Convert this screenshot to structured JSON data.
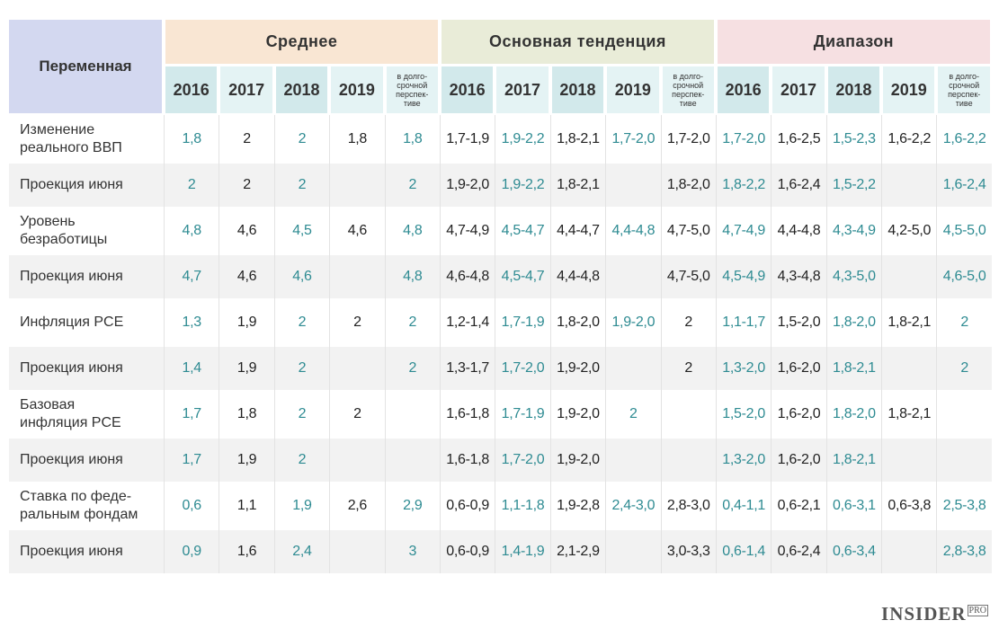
{
  "header": {
    "variable": "Переменная",
    "groups": [
      "Среднее",
      "Основная тенденция",
      "Диапазон"
    ],
    "years": [
      "2016",
      "2017",
      "2018",
      "2019"
    ],
    "long_term": "в долго-\nсрочной\nперспек-\nтиве"
  },
  "rows": [
    {
      "label": "Изменение\nреального ВВП",
      "cells": [
        "1,8",
        "2",
        "2",
        "1,8",
        "1,8",
        "1,7-1,9",
        "1,9-2,2",
        "1,8-2,1",
        "1,7-2,0",
        "1,7-2,0",
        "1,7-2,0",
        "1,6-2,5",
        "1,5-2,3",
        "1,6-2,2",
        "1,6-2,2"
      ]
    },
    {
      "label": "Проекция июня",
      "cells": [
        "2",
        "2",
        "2",
        "",
        "2",
        "1,9-2,0",
        "1,9-2,2",
        "1,8-2,1",
        "",
        "1,8-2,0",
        "1,8-2,2",
        "1,6-2,4",
        "1,5-2,2",
        "",
        "1,6-2,4"
      ]
    },
    {
      "label": "Уровень\nбезработицы",
      "cells": [
        "4,8",
        "4,6",
        "4,5",
        "4,6",
        "4,8",
        "4,7-4,9",
        "4,5-4,7",
        "4,4-4,7",
        "4,4-4,8",
        "4,7-5,0",
        "4,7-4,9",
        "4,4-4,8",
        "4,3-4,9",
        "4,2-5,0",
        "4,5-5,0"
      ]
    },
    {
      "label": "Проекция июня",
      "cells": [
        "4,7",
        "4,6",
        "4,6",
        "",
        "4,8",
        "4,6-4,8",
        "4,5-4,7",
        "4,4-4,8",
        "",
        "4,7-5,0",
        "4,5-4,9",
        "4,3-4,8",
        "4,3-5,0",
        "",
        "4,6-5,0"
      ]
    },
    {
      "label": "Инфляция PCE",
      "cells": [
        "1,3",
        "1,9",
        "2",
        "2",
        "2",
        "1,2-1,4",
        "1,7-1,9",
        "1,8-2,0",
        "1,9-2,0",
        "2",
        "1,1-1,7",
        "1,5-2,0",
        "1,8-2,0",
        "1,8-2,1",
        "2"
      ]
    },
    {
      "label": "Проекция июня",
      "cells": [
        "1,4",
        "1,9",
        "2",
        "",
        "2",
        "1,3-1,7",
        "1,7-2,0",
        "1,9-2,0",
        "",
        "2",
        "1,3-2,0",
        "1,6-2,0",
        "1,8-2,1",
        "",
        "2"
      ]
    },
    {
      "label": "Базовая\nинфляция PCE",
      "cells": [
        "1,7",
        "1,8",
        "2",
        "2",
        "",
        "1,6-1,8",
        "1,7-1,9",
        "1,9-2,0",
        "2",
        "",
        "1,5-2,0",
        "1,6-2,0",
        "1,8-2,0",
        "1,8-2,1",
        ""
      ]
    },
    {
      "label": "Проекция июня",
      "cells": [
        "1,7",
        "1,9",
        "2",
        "",
        "",
        "1,6-1,8",
        "1,7-2,0",
        "1,9-2,0",
        "",
        "",
        "1,3-2,0",
        "1,6-2,0",
        "1,8-2,1",
        "",
        ""
      ]
    },
    {
      "label": "Ставка по феде-\nральным фондам",
      "cells": [
        "0,6",
        "1,1",
        "1,9",
        "2,6",
        "2,9",
        "0,6-0,9",
        "1,1-1,8",
        "1,9-2,8",
        "2,4-3,0",
        "2,8-3,0",
        "0,4-1,1",
        "0,6-2,1",
        "0,6-3,1",
        "0,6-3,8",
        "2,5-3,8"
      ]
    },
    {
      "label": "Проекция июня",
      "cells": [
        "0,9",
        "1,6",
        "2,4",
        "",
        "3",
        "0,6-0,9",
        "1,4-1,9",
        "2,1-2,9",
        "",
        "3,0-3,3",
        "0,6-1,4",
        "0,6-2,4",
        "0,6-3,4",
        "",
        "2,8-3,8"
      ]
    }
  ],
  "colors": {
    "teal_text": "#2e8b92",
    "dark_text": "#222222",
    "mean_header": "#f9e6d3",
    "trend_header": "#e9ecd8",
    "range_header": "#f6e0e2",
    "variable_header": "#d3d8f0"
  },
  "logo": {
    "main": "INSIDER",
    "sub": "PRO"
  }
}
